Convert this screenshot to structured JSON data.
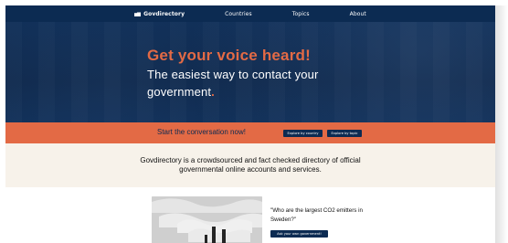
{
  "nav": {
    "brand_label": "Govdirectory",
    "items": [
      {
        "label": "Countries"
      },
      {
        "label": "Topics"
      },
      {
        "label": "About"
      }
    ]
  },
  "hero": {
    "title": "Get your voice heard!",
    "subtitle_line1": "The easiest way to contact your",
    "subtitle_line2": "government",
    "subtitle_punctuation": "."
  },
  "cta": {
    "label": "Start the conversation now!",
    "explore_country": "Explore by country",
    "explore_topic": "Explore by topic"
  },
  "info": {
    "text": "Govdirectory is a crowdsourced and fact checked directory of official governmental online accounts and services."
  },
  "feature": {
    "quote": "\"Who are the largest CO2 emitters in Sweden?\"",
    "button_label": "Ask your own government!"
  },
  "colors": {
    "navy": "#0c2b52",
    "accent": "#e36a45",
    "cream": "#f7f2ea"
  },
  "icons": {
    "brand": "folder-icon"
  }
}
